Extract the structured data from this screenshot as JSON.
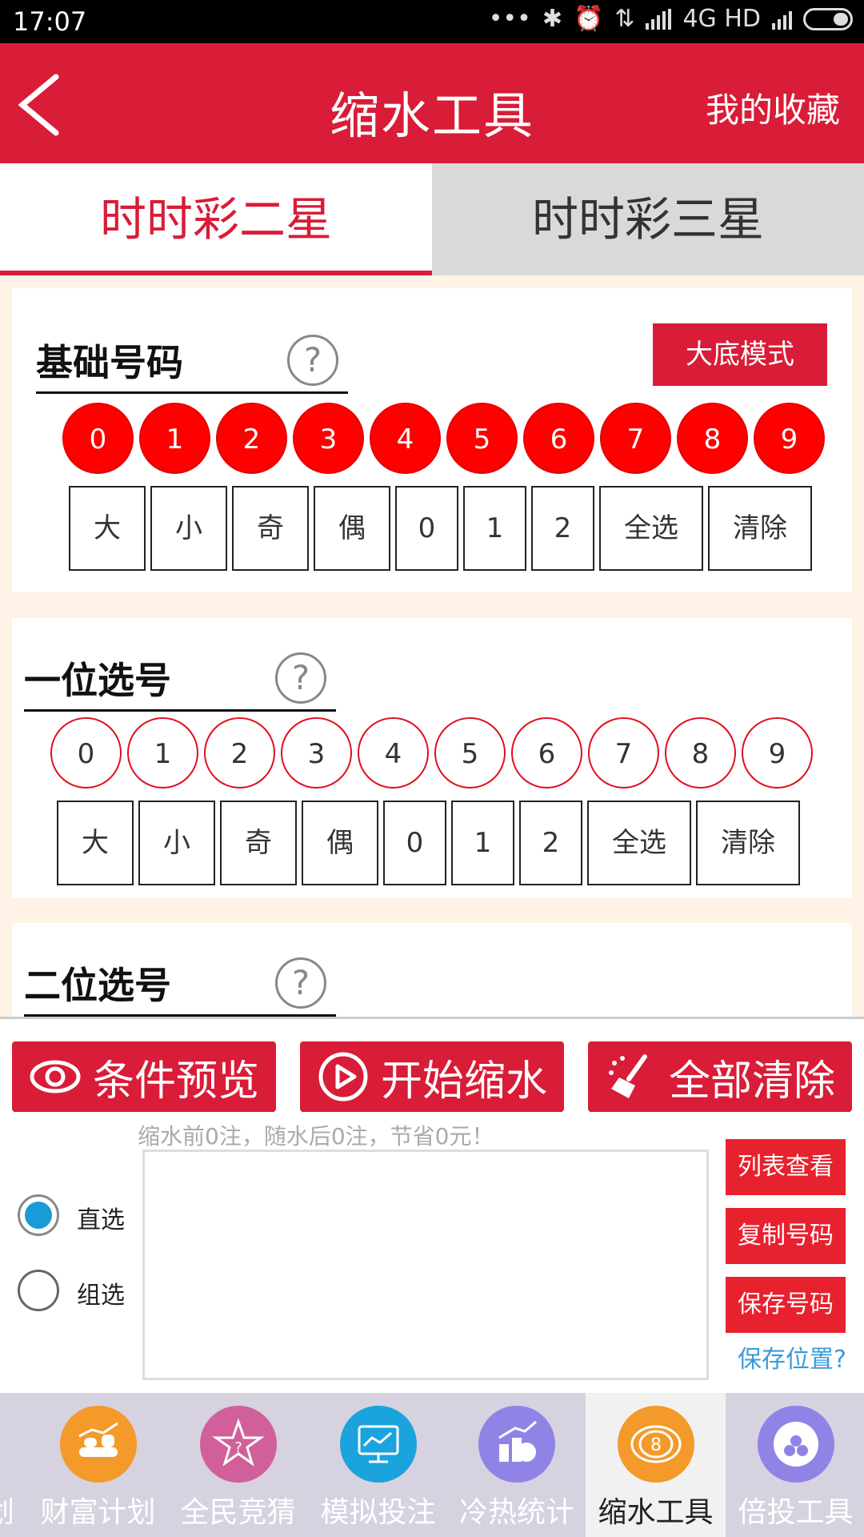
{
  "status_bar": {
    "time": "17:07",
    "network": "4G HD"
  },
  "app_bar": {
    "title": "缩水工具",
    "favorites": "我的收藏"
  },
  "tabs": [
    {
      "label": "时时彩二星",
      "active": true
    },
    {
      "label": "时时彩三星",
      "active": false
    }
  ],
  "section_base": {
    "title": "基础号码",
    "help": "?",
    "mode_button": "大底模式",
    "numbers": [
      "0",
      "1",
      "2",
      "3",
      "4",
      "5",
      "6",
      "7",
      "8",
      "9"
    ],
    "buttons": [
      "大",
      "小",
      "奇",
      "偶",
      "0",
      "1",
      "2",
      "全选",
      "清除"
    ]
  },
  "section_first": {
    "title": "一位选号",
    "help": "?",
    "numbers": [
      "0",
      "1",
      "2",
      "3",
      "4",
      "5",
      "6",
      "7",
      "8",
      "9"
    ],
    "buttons": [
      "大",
      "小",
      "奇",
      "偶",
      "0",
      "1",
      "2",
      "全选",
      "清除"
    ]
  },
  "section_second": {
    "title": "二位选号",
    "help": "?"
  },
  "actions": {
    "preview": "条件预览",
    "start": "开始缩水",
    "clear_all": "全部清除",
    "summary": "缩水前0注，随水后0注，节省0元！"
  },
  "options": {
    "direct": "直选",
    "group": "组选",
    "selected": "直选"
  },
  "side_buttons": {
    "list_view": "列表查看",
    "copy_numbers": "复制号码",
    "save_numbers": "保存号码",
    "save_location": "保存位置?"
  },
  "bottom_nav": [
    {
      "label": "划",
      "icon": "plan-icon"
    },
    {
      "label": "财富计划",
      "icon": "wealth-plan-icon",
      "color": "#f39a2b"
    },
    {
      "label": "全民竞猜",
      "icon": "guess-icon",
      "color": "#d1609a"
    },
    {
      "label": "模拟投注",
      "icon": "simulate-bet-icon",
      "color": "#1aa3dc"
    },
    {
      "label": "冷热统计",
      "icon": "hot-cold-stats-icon",
      "color": "#8f84e6"
    },
    {
      "label": "缩水工具",
      "icon": "shrink-tool-icon",
      "color": "#f39a2b",
      "active": true
    },
    {
      "label": "倍投工具",
      "icon": "multiple-bet-icon",
      "color": "#8f84e6"
    }
  ],
  "colors": {
    "primary": "#d91c37",
    "ball_red": "#ff0000",
    "accent_blue": "#1a9ad6"
  }
}
